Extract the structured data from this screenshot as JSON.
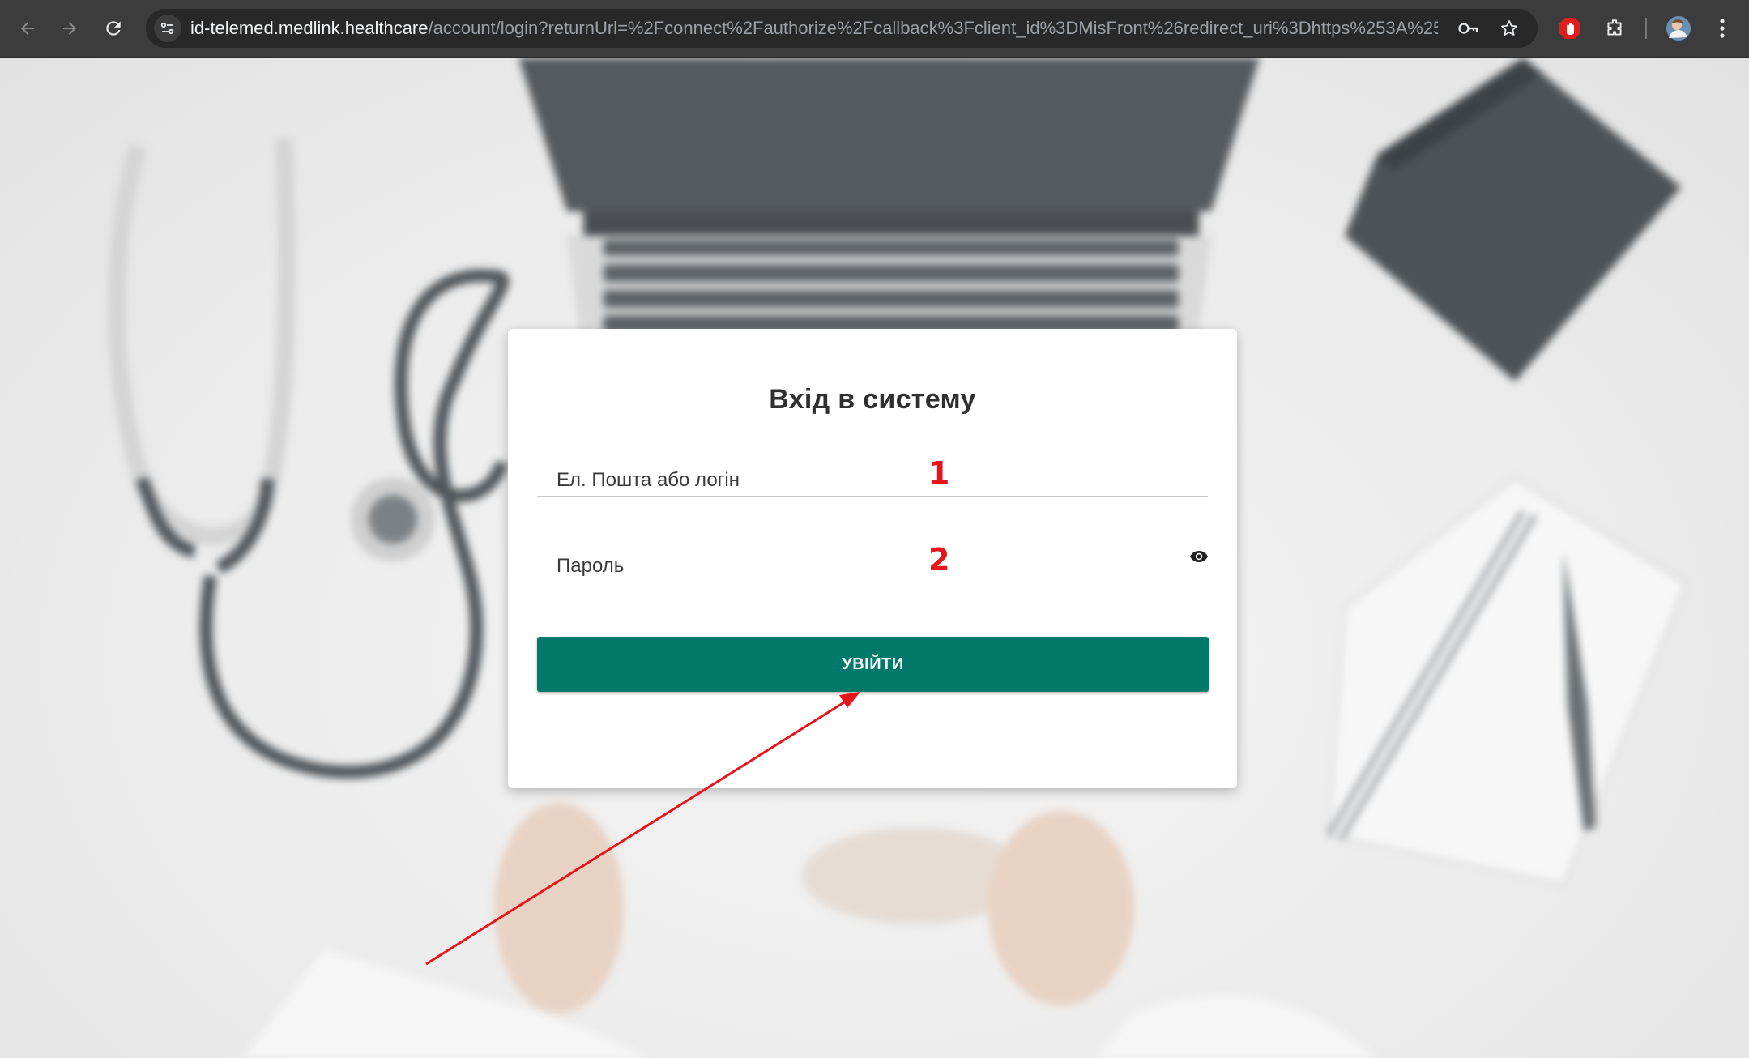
{
  "browser": {
    "url_host": "id-telemed.medlink.healthcare",
    "url_path": "/account/login?returnUrl=%2Fconnect%2Fauthorize%2Fcallback%3Fclient_id%3DMisFront%26redirect_uri%3Dhttps%253A%252F%252...",
    "icons": [
      "back-arrow-icon",
      "forward-arrow-icon",
      "reload-icon",
      "site-info-icon",
      "key-icon",
      "star-icon",
      "ad-block-icon",
      "extensions-icon",
      "profile-avatar",
      "kebab-menu-icon"
    ]
  },
  "login": {
    "title": "Вхід в систему",
    "login_placeholder": "Ел. Пошта або логін",
    "password_placeholder": "Пароль",
    "submit_label": "УВІЙТИ",
    "accent_color": "#00796b"
  },
  "annotations": {
    "marker_1": "1",
    "marker_2": "2",
    "color": "#e8141b"
  }
}
